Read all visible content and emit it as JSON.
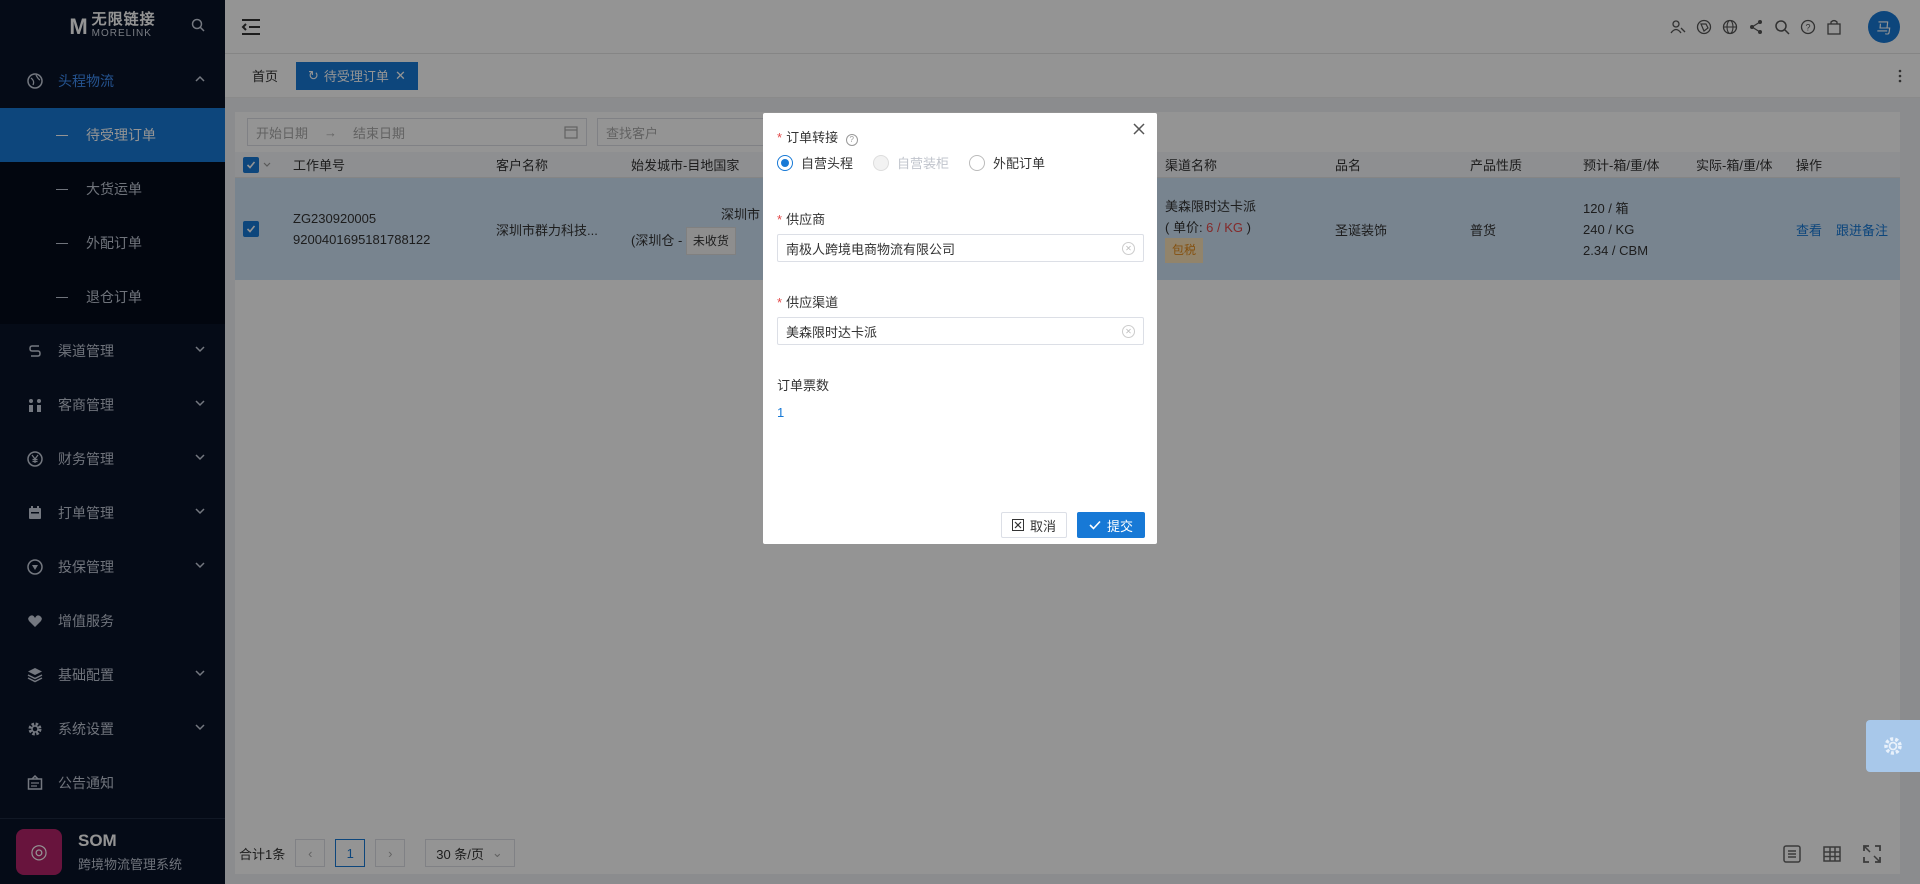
{
  "sidebar": {
    "logo_cn": "无限链接",
    "logo_en": "MORELINK",
    "menu": [
      {
        "label": "头程物流",
        "icon": "globe-icon",
        "expanded": true,
        "children": [
          "待受理订单",
          "大货运单",
          "外配订单",
          "退仓订单"
        ]
      },
      {
        "label": "渠道管理",
        "icon": "channel-icon"
      },
      {
        "label": "客商管理",
        "icon": "users-icon"
      },
      {
        "label": "财务管理",
        "icon": "yen-icon"
      },
      {
        "label": "打单管理",
        "icon": "print-icon"
      },
      {
        "label": "投保管理",
        "icon": "shield-icon"
      },
      {
        "label": "增值服务",
        "icon": "heart-icon"
      },
      {
        "label": "基础配置",
        "icon": "layers-icon"
      },
      {
        "label": "系统设置",
        "icon": "gear-icon"
      },
      {
        "label": "公告通知",
        "icon": "notice-icon"
      }
    ],
    "footer_title": "SOM",
    "footer_subtitle": "跨境物流管理系统"
  },
  "header": {
    "avatar_text": "马"
  },
  "tabs": [
    {
      "label": "首页"
    },
    {
      "label": "待受理订单"
    }
  ],
  "filters": {
    "start_placeholder": "开始日期",
    "end_placeholder": "结束日期",
    "customer_placeholder": "查找客户"
  },
  "table": {
    "headers": [
      "工作单号",
      "客户名称",
      "始发城市-目地国家",
      "渠道名称",
      "品名",
      "产品性质",
      "预计-箱/重/体",
      "实际-箱/重/体",
      "操作"
    ],
    "row": {
      "work_no": "ZG230920005",
      "tracking_no": "9200401695181788122",
      "customer": "深圳市群力科技...",
      "city_top": "深圳市",
      "city_bottom": "(深圳仓 -",
      "status_tag": "未收货",
      "channel_name": "美森限时达卡派",
      "price_prefix": "( 单价: ",
      "price_value": "6 / KG",
      "price_suffix": " )",
      "tax_tag": "包税",
      "product": "圣诞装饰",
      "nature": "普货",
      "est_box": "120 / 箱",
      "est_weight": "240 / KG",
      "est_volume": "2.34 / CBM",
      "action_view": "查看",
      "action_follow": "跟进备注"
    }
  },
  "pager": {
    "total": "合计1条",
    "current": "1",
    "size": "30 条/页"
  },
  "modal": {
    "transfer_label": "订单转接",
    "radios": [
      {
        "label": "自营头程",
        "checked": true,
        "disabled": false
      },
      {
        "label": "自营装柜",
        "checked": false,
        "disabled": true
      },
      {
        "label": "外配订单",
        "checked": false,
        "disabled": false
      }
    ],
    "supplier_label": "供应商",
    "supplier_value": "南极人跨境电商物流有限公司",
    "channel_label": "供应渠道",
    "channel_value": "美森限时达卡派",
    "count_label": "订单票数",
    "count_value": "1",
    "cancel_label": "取消",
    "submit_label": "提交"
  },
  "colors": {
    "primary": "#1779d6",
    "sidebar_bg": "#0a1428",
    "required": "#e34848"
  }
}
